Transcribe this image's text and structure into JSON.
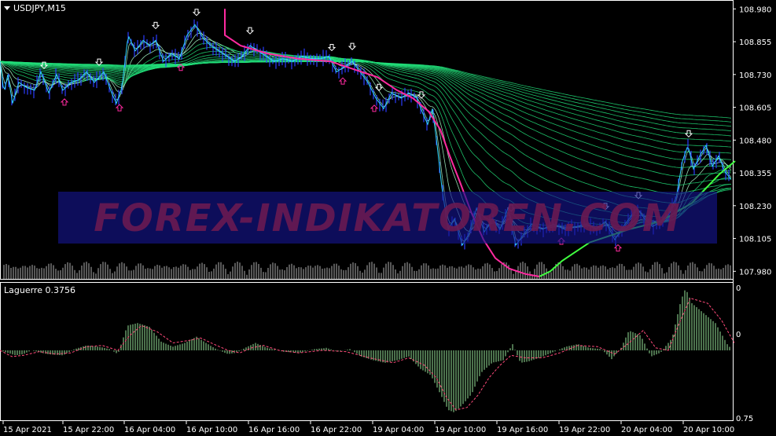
{
  "symbol_title": "USDJPY,M15",
  "indicator_title": "Laguerre 0.3756",
  "watermark": "FOREX-INDIKATOREN.COM",
  "colors": {
    "background": "#000000",
    "ribbon": "#22e07a",
    "ribbon_light": "#aaffcc",
    "price_bars": "#2b3cff",
    "line_cyan": "#30d8ff",
    "magenta_line": "#ff2aa0",
    "slow_line": "#40ff40",
    "volume": "#b0b0b0",
    "osc_bars": "#98e49a",
    "osc_signal": "#ff4a7a",
    "arrow_up": "#ff2aa0",
    "arrow_down": "#ffffff",
    "watermark_bg": "#14148a",
    "watermark_text": "#6a1a52"
  },
  "price_axis": {
    "ticks": [
      "108.980",
      "108.855",
      "108.730",
      "108.605",
      "108.480",
      "108.355",
      "108.230",
      "108.105",
      "107.980"
    ]
  },
  "osc_axis": {
    "top_label": "0",
    "mid_label": "0",
    "bottom_label": "0.75"
  },
  "time_axis": {
    "labels": [
      "15 Apr 2021",
      "15 Apr 22:00",
      "16 Apr 04:00",
      "16 Apr 10:00",
      "16 Apr 16:00",
      "16 Apr 22:00",
      "19 Apr 04:00",
      "19 Apr 10:00",
      "19 Apr 16:00",
      "19 Apr 22:00",
      "20 Apr 04:00",
      "20 Apr 10:00"
    ]
  },
  "chart_data": [
    {
      "type": "line",
      "title": "USDJPY,M15",
      "x": [
        "15 Apr 2021",
        "15 Apr 22:00",
        "16 Apr 04:00",
        "16 Apr 10:00",
        "16 Apr 16:00",
        "16 Apr 22:00",
        "19 Apr 04:00",
        "19 Apr 10:00",
        "19 Apr 16:00",
        "19 Apr 22:00",
        "20 Apr 04:00",
        "20 Apr 10:00"
      ],
      "ylim": [
        107.96,
        108.99
      ],
      "series": [
        {
          "name": "price",
          "values": [
            [
              0,
              108.78
            ],
            [
              5,
              108.66
            ],
            [
              10,
              108.73
            ],
            [
              16,
              108.62
            ],
            [
              24,
              108.7
            ],
            [
              34,
              108.68
            ],
            [
              44,
              108.67
            ],
            [
              52,
              108.74
            ],
            [
              62,
              108.66
            ],
            [
              72,
              108.73
            ],
            [
              80,
              108.67
            ],
            [
              90,
              108.7
            ],
            [
              100,
              108.71
            ],
            [
              110,
              108.74
            ],
            [
              120,
              108.7
            ],
            [
              132,
              108.74
            ],
            [
              142,
              108.66
            ],
            [
              148,
              108.62
            ],
            [
              155,
              108.68
            ],
            [
              163,
              108.88
            ],
            [
              172,
              108.82
            ],
            [
              182,
              108.86
            ],
            [
              190,
              108.84
            ],
            [
              198,
              108.86
            ],
            [
              208,
              108.78
            ],
            [
              218,
              108.81
            ],
            [
              228,
              108.79
            ],
            [
              238,
              108.88
            ],
            [
              248,
              108.92
            ],
            [
              258,
              108.87
            ],
            [
              268,
              108.84
            ],
            [
              278,
              108.82
            ],
            [
              288,
              108.8
            ],
            [
              298,
              108.78
            ],
            [
              308,
              108.8
            ],
            [
              318,
              108.84
            ],
            [
              328,
              108.82
            ],
            [
              338,
              108.8
            ],
            [
              348,
              108.78
            ],
            [
              360,
              108.79
            ],
            [
              372,
              108.78
            ],
            [
              384,
              108.8
            ],
            [
              396,
              108.79
            ],
            [
              408,
              108.79
            ],
            [
              418,
              108.8
            ],
            [
              428,
              108.74
            ],
            [
              438,
              108.76
            ],
            [
              448,
              108.78
            ],
            [
              458,
              108.74
            ],
            [
              468,
              108.7
            ],
            [
              478,
              108.64
            ],
            [
              488,
              108.6
            ],
            [
              498,
              108.66
            ],
            [
              510,
              108.64
            ],
            [
              520,
              108.66
            ],
            [
              530,
              108.64
            ],
            [
              538,
              108.58
            ],
            [
              544,
              108.54
            ],
            [
              550,
              108.6
            ],
            [
              556,
              108.46
            ],
            [
              562,
              108.3
            ],
            [
              570,
              108.14
            ],
            [
              578,
              108.18
            ],
            [
              588,
              108.08
            ],
            [
              596,
              108.12
            ],
            [
              606,
              108.22
            ],
            [
              616,
              108.13
            ],
            [
              626,
              108.18
            ],
            [
              636,
              108.14
            ],
            [
              646,
              108.22
            ],
            [
              656,
              108.08
            ],
            [
              666,
              108.12
            ],
            [
              676,
              108.16
            ],
            [
              690,
              108.14
            ],
            [
              704,
              108.16
            ],
            [
              718,
              108.14
            ],
            [
              732,
              108.15
            ],
            [
              746,
              108.16
            ],
            [
              758,
              108.14
            ],
            [
              770,
              108.17
            ],
            [
              782,
              108.1
            ],
            [
              790,
              108.14
            ],
            [
              800,
              108.18
            ],
            [
              810,
              108.22
            ],
            [
              820,
              108.18
            ],
            [
              830,
              108.15
            ],
            [
              840,
              108.17
            ],
            [
              850,
              108.2
            ],
            [
              860,
              108.26
            ],
            [
              868,
              108.4
            ],
            [
              875,
              108.46
            ],
            [
              882,
              108.37
            ],
            [
              890,
              108.42
            ],
            [
              898,
              108.46
            ],
            [
              906,
              108.38
            ],
            [
              914,
              108.42
            ],
            [
              922,
              108.36
            ],
            [
              930,
              108.33
            ]
          ]
        },
        {
          "name": "magenta",
          "values": [
            [
              286,
              108.98
            ],
            [
              286,
              108.88
            ],
            [
              306,
              108.84
            ],
            [
              340,
              108.81
            ],
            [
              380,
              108.79
            ],
            [
              420,
              108.78
            ],
            [
              450,
              108.75
            ],
            [
              480,
              108.72
            ],
            [
              505,
              108.67
            ],
            [
              525,
              108.64
            ],
            [
              545,
              108.59
            ],
            [
              560,
              108.52
            ],
            [
              572,
              108.42
            ],
            [
              585,
              108.32
            ],
            [
              600,
              108.2
            ],
            [
              615,
              108.1
            ],
            [
              630,
              108.03
            ],
            [
              648,
              107.99
            ],
            [
              668,
              107.97
            ],
            [
              686,
              107.96
            ]
          ]
        },
        {
          "name": "slow",
          "values": [
            [
              686,
              107.96
            ],
            [
              700,
              107.98
            ],
            [
              715,
              108.02
            ],
            [
              730,
              108.05
            ],
            [
              750,
              108.09
            ],
            [
              770,
              108.11
            ],
            [
              800,
              108.14
            ],
            [
              840,
              108.17
            ],
            [
              880,
              108.24
            ],
            [
              915,
              108.35
            ],
            [
              935,
              108.4
            ]
          ]
        }
      ]
    },
    {
      "type": "bar",
      "title": "Laguerre 0.3756",
      "ylim": [
        0,
        1
      ],
      "series": [
        {
          "name": "laguerre",
          "values": [
            [
              0,
              0.5
            ],
            [
              10,
              0.48
            ],
            [
              20,
              0.46
            ],
            [
              30,
              0.47
            ],
            [
              40,
              0.5
            ],
            [
              60,
              0.47
            ],
            [
              80,
              0.46
            ],
            [
              95,
              0.51
            ],
            [
              110,
              0.54
            ],
            [
              125,
              0.53
            ],
            [
              140,
              0.51
            ],
            [
              150,
              0.47
            ],
            [
              162,
              0.7
            ],
            [
              175,
              0.72
            ],
            [
              190,
              0.69
            ],
            [
              205,
              0.57
            ],
            [
              220,
              0.53
            ],
            [
              235,
              0.56
            ],
            [
              250,
              0.61
            ],
            [
              262,
              0.56
            ],
            [
              275,
              0.51
            ],
            [
              290,
              0.47
            ],
            [
              300,
              0.48
            ],
            [
              315,
              0.53
            ],
            [
              325,
              0.56
            ],
            [
              340,
              0.52
            ],
            [
              360,
              0.49
            ],
            [
              380,
              0.48
            ],
            [
              400,
              0.51
            ],
            [
              415,
              0.52
            ],
            [
              430,
              0.49
            ],
            [
              445,
              0.51
            ],
            [
              460,
              0.45
            ],
            [
              475,
              0.42
            ],
            [
              490,
              0.4
            ],
            [
              505,
              0.42
            ],
            [
              520,
              0.45
            ],
            [
              535,
              0.35
            ],
            [
              548,
              0.3
            ],
            [
              560,
              0.15
            ],
            [
              570,
              0.02
            ],
            [
              578,
              0.0
            ],
            [
              588,
              0.06
            ],
            [
              600,
              0.15
            ],
            [
              612,
              0.32
            ],
            [
              626,
              0.4
            ],
            [
              640,
              0.42
            ],
            [
              652,
              0.55
            ],
            [
              662,
              0.4
            ],
            [
              672,
              0.41
            ],
            [
              690,
              0.45
            ],
            [
              705,
              0.49
            ],
            [
              720,
              0.53
            ],
            [
              735,
              0.55
            ],
            [
              750,
              0.52
            ],
            [
              765,
              0.51
            ],
            [
              778,
              0.43
            ],
            [
              790,
              0.52
            ],
            [
              800,
              0.66
            ],
            [
              815,
              0.62
            ],
            [
              828,
              0.45
            ],
            [
              840,
              0.48
            ],
            [
              855,
              0.6
            ],
            [
              866,
              0.9
            ],
            [
              872,
              1.0
            ],
            [
              880,
              0.88
            ],
            [
              895,
              0.8
            ],
            [
              910,
              0.72
            ],
            [
              925,
              0.55
            ],
            [
              932,
              0.5
            ]
          ]
        },
        {
          "name": "signal",
          "values": [
            [
              0,
              0.5
            ],
            [
              15,
              0.45
            ],
            [
              30,
              0.46
            ],
            [
              50,
              0.49
            ],
            [
              70,
              0.47
            ],
            [
              90,
              0.48
            ],
            [
              110,
              0.53
            ],
            [
              130,
              0.54
            ],
            [
              150,
              0.5
            ],
            [
              165,
              0.62
            ],
            [
              180,
              0.7
            ],
            [
              200,
              0.65
            ],
            [
              220,
              0.56
            ],
            [
              240,
              0.58
            ],
            [
              255,
              0.6
            ],
            [
              272,
              0.55
            ],
            [
              290,
              0.5
            ],
            [
              305,
              0.48
            ],
            [
              320,
              0.52
            ],
            [
              335,
              0.54
            ],
            [
              355,
              0.5
            ],
            [
              380,
              0.48
            ],
            [
              410,
              0.5
            ],
            [
              440,
              0.49
            ],
            [
              470,
              0.44
            ],
            [
              500,
              0.4
            ],
            [
              520,
              0.44
            ],
            [
              540,
              0.38
            ],
            [
              555,
              0.28
            ],
            [
              568,
              0.12
            ],
            [
              580,
              0.02
            ],
            [
              594,
              0.04
            ],
            [
              608,
              0.14
            ],
            [
              622,
              0.28
            ],
            [
              636,
              0.38
            ],
            [
              650,
              0.46
            ],
            [
              668,
              0.44
            ],
            [
              690,
              0.44
            ],
            [
              712,
              0.48
            ],
            [
              735,
              0.54
            ],
            [
              760,
              0.53
            ],
            [
              782,
              0.47
            ],
            [
              800,
              0.56
            ],
            [
              818,
              0.66
            ],
            [
              834,
              0.52
            ],
            [
              850,
              0.5
            ],
            [
              864,
              0.72
            ],
            [
              878,
              0.92
            ],
            [
              900,
              0.88
            ],
            [
              918,
              0.74
            ],
            [
              934,
              0.56
            ]
          ]
        }
      ]
    }
  ]
}
